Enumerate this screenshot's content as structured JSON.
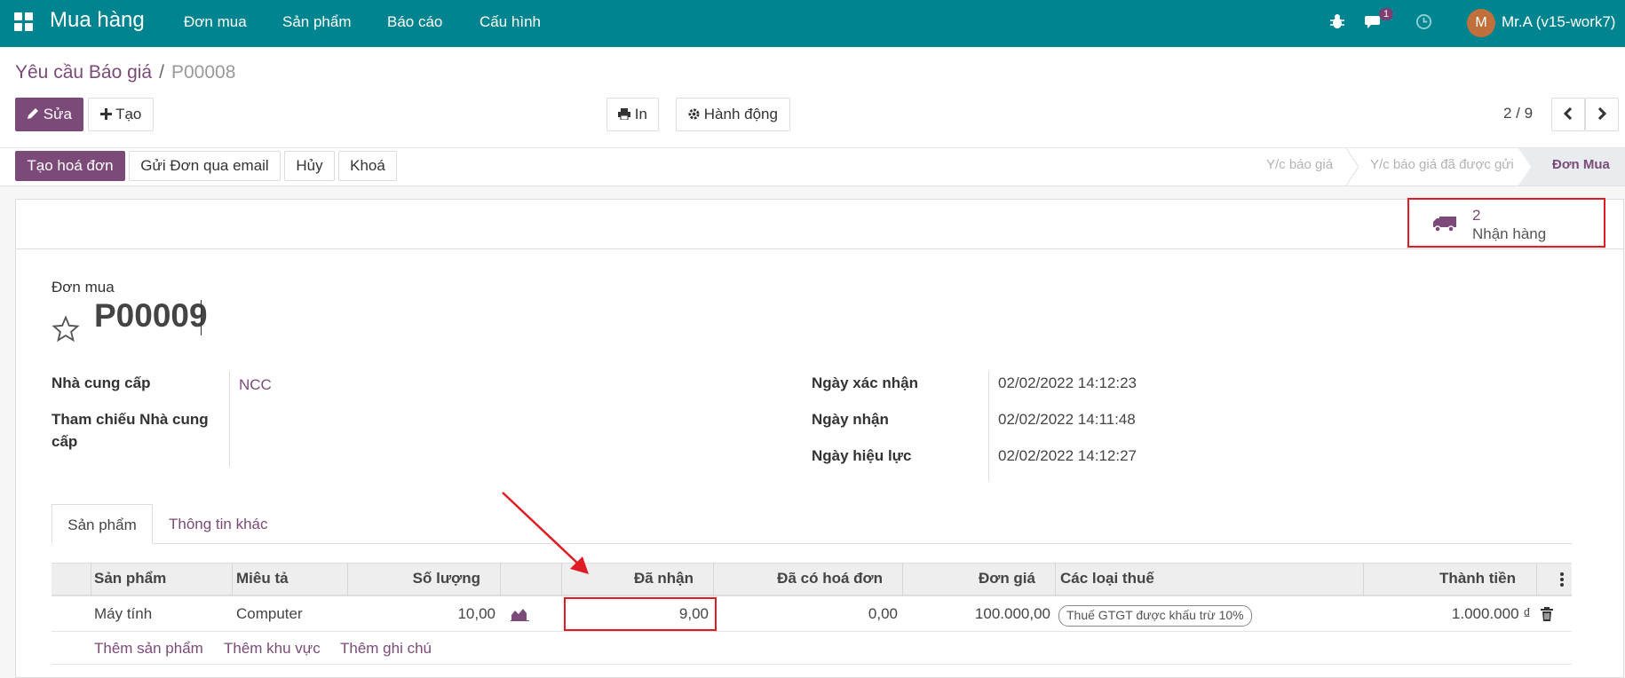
{
  "topbar": {
    "brand": "Mua hàng",
    "menu": [
      "Đơn mua",
      "Sản phẩm",
      "Báo cáo",
      "Cấu hình"
    ],
    "message_count": "1",
    "avatar_letter": "M",
    "user": "Mr.A (v15-work7)"
  },
  "breadcrumb": {
    "parent": "Yêu cầu Báo giá",
    "separator": "/",
    "current": "P00008"
  },
  "actions": {
    "edit": "Sửa",
    "create": "Tạo",
    "print": "In",
    "action": "Hành động",
    "pager": "2 / 9"
  },
  "header_buttons": {
    "invoice": "Tạo hoá đơn",
    "email": "Gửi Đơn qua email",
    "cancel": "Hủy",
    "lock": "Khoá"
  },
  "stages": [
    "Y/c báo giá",
    "Y/c báo giá đã được gửi",
    "Đơn Mua"
  ],
  "smart_button": {
    "count": "2",
    "label": "Nhận hàng"
  },
  "form": {
    "title_label": "Đơn mua",
    "title": "P00009",
    "supplier_label": "Nhà cung cấp",
    "supplier": "NCC",
    "supplier_ref_label_1": "Tham chiếu Nhà cung",
    "supplier_ref_label_2": "cấp",
    "confirm_date_label": "Ngày xác nhận",
    "confirm_date": "02/02/2022 14:12:23",
    "receipt_date_label": "Ngày nhận",
    "receipt_date": "02/02/2022 14:11:48",
    "effective_date_label": "Ngày hiệu lực",
    "effective_date": "02/02/2022 14:12:27"
  },
  "tabs": {
    "products": "Sản phẩm",
    "other": "Thông tin khác"
  },
  "table": {
    "headers": {
      "product": "Sản phẩm",
      "description": "Miêu tả",
      "quantity": "Số lượng",
      "received": "Đã nhận",
      "billed": "Đã có hoá đơn",
      "unit_price": "Đơn giá",
      "taxes": "Các loại thuế",
      "subtotal": "Thành tiền"
    },
    "row": {
      "product": "Máy tính",
      "description": "Computer",
      "quantity": "10,00",
      "received": "9,00",
      "billed": "0,00",
      "unit_price": "100.000,00",
      "tax": "Thuế GTGT được khấu trừ 10%",
      "subtotal": "1.000.000 ₫"
    },
    "add": {
      "product": "Thêm sản phẩm",
      "section": "Thêm khu vực",
      "note": "Thêm ghi chú"
    }
  }
}
